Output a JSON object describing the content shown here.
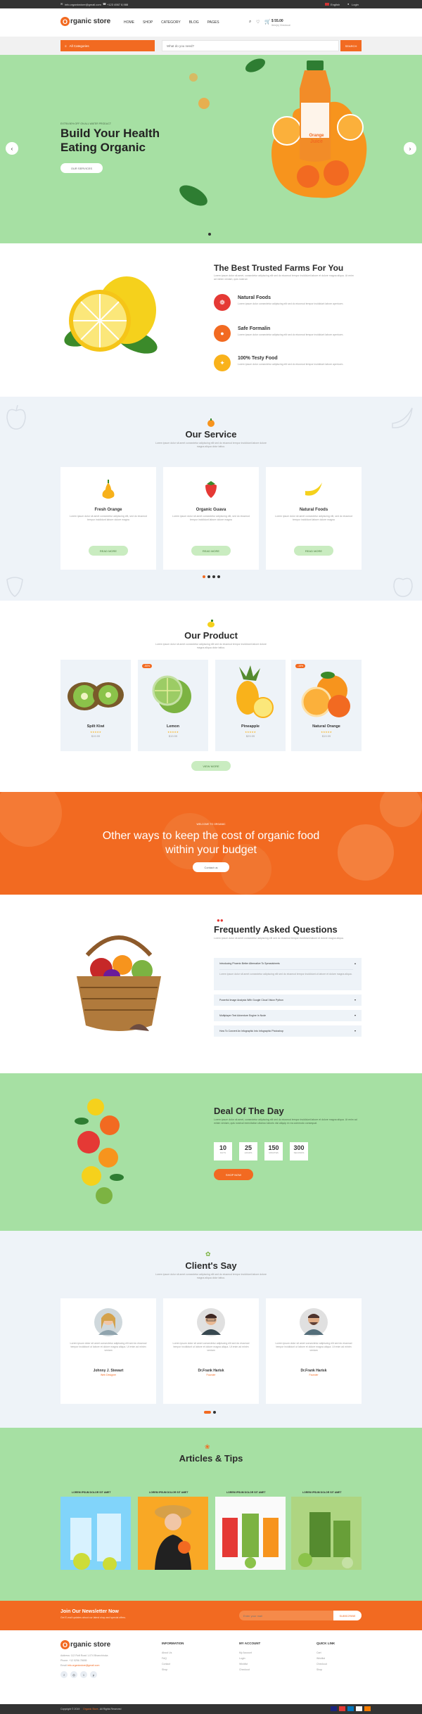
{
  "topbar": {
    "email": "info.organicstore@gmail.com",
    "phone": "+123 4567 8,988",
    "language": "English",
    "login": "Login"
  },
  "brand": {
    "name": "rganic store",
    "initial": "O"
  },
  "nav": {
    "items": [
      "HOME",
      "SHOP",
      "CATEGORY",
      "BLOG",
      "PAGES"
    ],
    "cart_total": "$ 55.00",
    "cart_sub": "Item(s)  Checkout"
  },
  "search": {
    "category": "All Categories",
    "placeholder": "What do you need?",
    "button": "SEARCH"
  },
  "hero": {
    "kicker": "EXTRA 50% OFF ON ALL WATER PRODUCT",
    "title_1": "Build Your Health",
    "title_2": "Eating Organic",
    "button": "OUR SERVICES",
    "bottle_label_1": "Orange",
    "bottle_label_2": "Juice"
  },
  "farms": {
    "title": "The Best Trusted Farms For You",
    "intro": "Lorem ipsum dolor sit amet, consectetur adipiscing elit sed do eiusmod tempor incididunt labore et dolore magna aliqua. Ut enim ad minim veniam, quis nostrud.",
    "items": [
      {
        "title": "Natural Foods",
        "text": "Lorem ipsum dolor consectetur adipiscing elit sed do eiusmod tempor incididunt labore aperiovm."
      },
      {
        "title": "Safe Formalin",
        "text": "Lorem ipsum dolor consectetur adipiscing elit sed do eiusmod tempor incididunt labore aperiovm."
      },
      {
        "title": "100% Testy Food",
        "text": "Lorem ipsum dolor consectetur adipiscing elit sed do eiusmod tempor incididunt labore aperiovm."
      }
    ]
  },
  "service": {
    "title": "Our Service",
    "sub_1": "Lorem ipsum dolor sit amet consectetur adipiscing elit sed do eiusmod tempor incididunt labore dolore",
    "sub_2": "magna aliqua dolor tattoo.",
    "cards": [
      {
        "title": "Fresh Orange",
        "text": "Lorem ipsum dolor sit amet consectetur adipiscing elit, sed do eiusmod tempor incididunt labore dolore magna",
        "button": "READ MORE"
      },
      {
        "title": "Organic Guava",
        "text": "Lorem ipsum dolor sit amet consectetur adipiscing elit, sed do eiusmod tempor incididunt labore dolore magna",
        "button": "READ MORE"
      },
      {
        "title": "Natural Foods",
        "text": "Lorem ipsum dolor sit amet consectetur adipiscing elit, sed do eiusmod tempor incididunt labore dolore magna",
        "button": "READ MORE"
      }
    ]
  },
  "products": {
    "title": "Our Product",
    "sub_1": "Lorem ipsum dolor sit amet consectetur adipiscing elit sed do eiusmod tempor incididunt labore dolore",
    "sub_2": "magna aliqua dolor tattoo.",
    "items": [
      {
        "name": "Spilt Kiwi",
        "price": "$19.99",
        "badge": ""
      },
      {
        "name": "Lemon",
        "price": "$19.99",
        "badge": "-50%"
      },
      {
        "name": "Pineapple",
        "price": "$29.99",
        "badge": ""
      },
      {
        "name": "Natural Orange",
        "price": "$19.99",
        "badge": "-15%"
      }
    ],
    "view_more": "VIEW MORE"
  },
  "banner": {
    "kicker": "WELCOME TO ORGANIC",
    "title_1": "Other ways to keep the cost of organic food",
    "title_2": "within your budget",
    "button": "Contact us"
  },
  "faq": {
    "title": "Frequently Asked Questions",
    "sub": "Lorem ipsum dolor sit amet consectetur adipiscing elit sed do eiusmod tempor incididunt labore et dolore magna aliqua.",
    "items": [
      "Introducing Phoenix Better Alternative To Spreadsheets",
      "Powerful Image Analysis With Google Cloud Vision Python",
      "Multiplayer Text Adventure Engine In Node",
      "How To Convert An Infographic Into Infographic Photoshop"
    ],
    "open_text": "Lorem ipsum dolor sit amet consectetur adipiscing elit sed do eiusmod tempor incididunt ut labore et dolore magna aliqua."
  },
  "deal": {
    "title": "Deal Of The Day",
    "text": "Lorem ipsum dolor sit amet, consectetur adipiscing elit sed do eiusmod tempor incididunt labore et dolore magna aliqua. Ut enim ad minim veniam, quis nostrud exercitation ullamco laboris nisi aliquip ex ea commodo consequat.",
    "timer": [
      {
        "value": "10",
        "unit": "DAYS"
      },
      {
        "value": "25",
        "unit": "HOURS"
      },
      {
        "value": "150",
        "unit": "MINUTES"
      },
      {
        "value": "300",
        "unit": "SECONDS"
      }
    ],
    "button": "SHOP NOW"
  },
  "clients": {
    "title": "Client's Say",
    "sub_1": "Lorem ipsum dolor sit amet consectetur adipiscing elit sed do eiusmod tempor incididunt labore dolore",
    "sub_2": "magna aliqua dolor tattoo.",
    "items": [
      {
        "text": "Lorem ipsum dolor sit amet consectetur adipiscing elit sed do eiusmod tempor incididunt ut labore et dolore magna aliqua. Ut enim ad minim veniam",
        "name": "Johnny J. Stewart",
        "role": "Web Designer"
      },
      {
        "text": "Lorem ipsum dolor sit amet consectetur adipiscing elit sed do eiusmod tempor incididunt ut labore et dolore magna aliqua. Ut enim ad minim veniam",
        "name": "Dr.Frank Harisk",
        "role": "Founder"
      },
      {
        "text": "Lorem ipsum dolor sit amet consectetur adipiscing elit sed do eiusmod tempor incididunt ut labore et dolore magna aliqua. Ut enim ad minim veniam",
        "name": "Dr.Frank Harisk",
        "role": "Founder"
      }
    ]
  },
  "articles": {
    "title": "Articles & Tips",
    "items": [
      "LOREM IPSUM DOLOR SIT AMET",
      "LOREM IPSUM DOLOR SIT AMET",
      "LOREM IPSUM DOLOR SIT AMET",
      "LOREM IPSUM DOLOR SIT AMET"
    ]
  },
  "newsletter": {
    "title": "Join Our Newsletter Now",
    "sub": "Get E-mail updates about our latest shop and special offers.",
    "placeholder": "Enter your mail",
    "button": "SUBSCRIBE"
  },
  "footer": {
    "address": "Address: 112 Roft Road 1-074 Bhanchhoka",
    "phone": "Phone: +12 5256 78655",
    "email_label": "Email:",
    "email": "info.organicstore@gmail.com",
    "columns": [
      {
        "title": "INFORMATION",
        "links": [
          "About Us",
          "FAQ",
          "Contact",
          "Shop"
        ]
      },
      {
        "title": "MY ACCOUNT",
        "links": [
          "My Account",
          "Login",
          "Wishlist",
          "Checkout"
        ]
      },
      {
        "title": "QUICK LINK",
        "links": [
          "Cart",
          "Wishlist",
          "Checkout",
          "Shop"
        ]
      }
    ],
    "copyright_1": "Copyright © 2019",
    "copyright_brand": "Organic Store",
    "copyright_2": ". All Rights Reserved"
  }
}
